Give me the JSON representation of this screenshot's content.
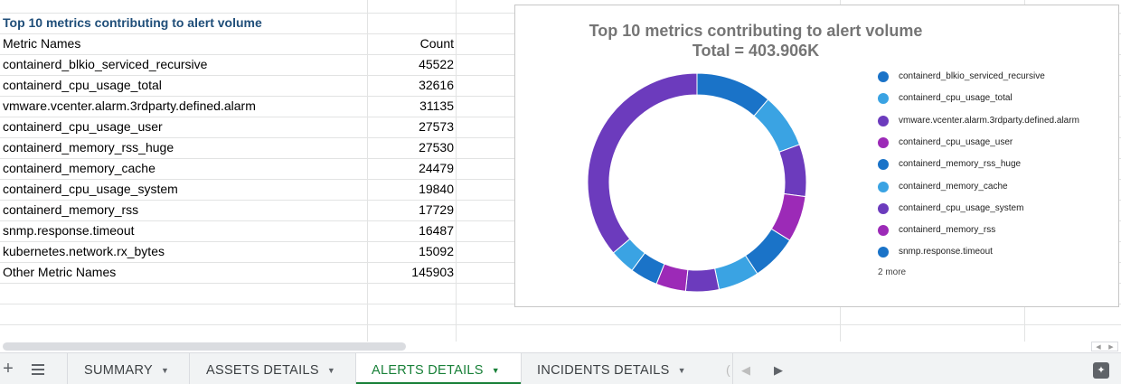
{
  "sheet": {
    "table_title": "Top 10 metrics contributing to alert volume",
    "col_name_header": "Metric Names",
    "col_count_header": "Count",
    "rows": [
      {
        "name": "containerd_blkio_serviced_recursive",
        "count": "45522"
      },
      {
        "name": "containerd_cpu_usage_total",
        "count": "32616"
      },
      {
        "name": "vmware.vcenter.alarm.3rdparty.defined.alarm",
        "count": "31135"
      },
      {
        "name": "containerd_cpu_usage_user",
        "count": "27573"
      },
      {
        "name": "containerd_memory_rss_huge",
        "count": "27530"
      },
      {
        "name": "containerd_memory_cache",
        "count": "24479"
      },
      {
        "name": "containerd_cpu_usage_system",
        "count": "19840"
      },
      {
        "name": "containerd_memory_rss",
        "count": "17729"
      },
      {
        "name": "snmp.response.timeout",
        "count": "16487"
      },
      {
        "name": "kubernetes.network.rx_bytes",
        "count": "15092"
      },
      {
        "name": "Other Metric Names",
        "count": "145903"
      }
    ]
  },
  "chart_data": {
    "type": "pie",
    "donut": true,
    "title": "Top 10 metrics contributing to alert volume",
    "subtitle": "Total = 403.906K",
    "categories": [
      "containerd_blkio_serviced_recursive",
      "containerd_cpu_usage_total",
      "vmware.vcenter.alarm.3rdparty.defined.alarm",
      "containerd_cpu_usage_user",
      "containerd_memory_rss_huge",
      "containerd_memory_cache",
      "containerd_cpu_usage_system",
      "containerd_memory_rss",
      "snmp.response.timeout",
      "kubernetes.network.rx_bytes",
      "Other Metric Names"
    ],
    "values": [
      45522,
      32616,
      31135,
      27573,
      27530,
      24479,
      19840,
      17729,
      16487,
      15092,
      145903
    ],
    "colors": [
      "#1a73c8",
      "#3aa3e3",
      "#6c3bbd",
      "#9c2ab7",
      "#1a73c8",
      "#3aa3e3",
      "#6c3bbd",
      "#9c2ab7",
      "#1a73c8",
      "#3aa3e3",
      "#6c3bbd"
    ],
    "legend_items": [
      "containerd_blkio_serviced_recursive",
      "containerd_cpu_usage_total",
      "vmware.vcenter.alarm.3rdparty.defined.alarm",
      "containerd_cpu_usage_user",
      "containerd_memory_rss_huge",
      "containerd_memory_cache",
      "containerd_cpu_usage_system",
      "containerd_memory_rss",
      "snmp.response.timeout"
    ],
    "legend_more": "2 more",
    "legend_position": "right"
  },
  "tabbar": {
    "add_icon": "plus-icon",
    "menu_icon": "hamburger-icon",
    "tabs": [
      {
        "label": "SUMMARY",
        "active": false
      },
      {
        "label": "ASSETS DETAILS",
        "active": false
      },
      {
        "label": "ALERTS DETAILS",
        "active": true
      },
      {
        "label": "INCIDENTS DETAILS",
        "active": false
      }
    ],
    "active_color": "#188038",
    "explore_icon": "explore-sparkle-icon"
  }
}
